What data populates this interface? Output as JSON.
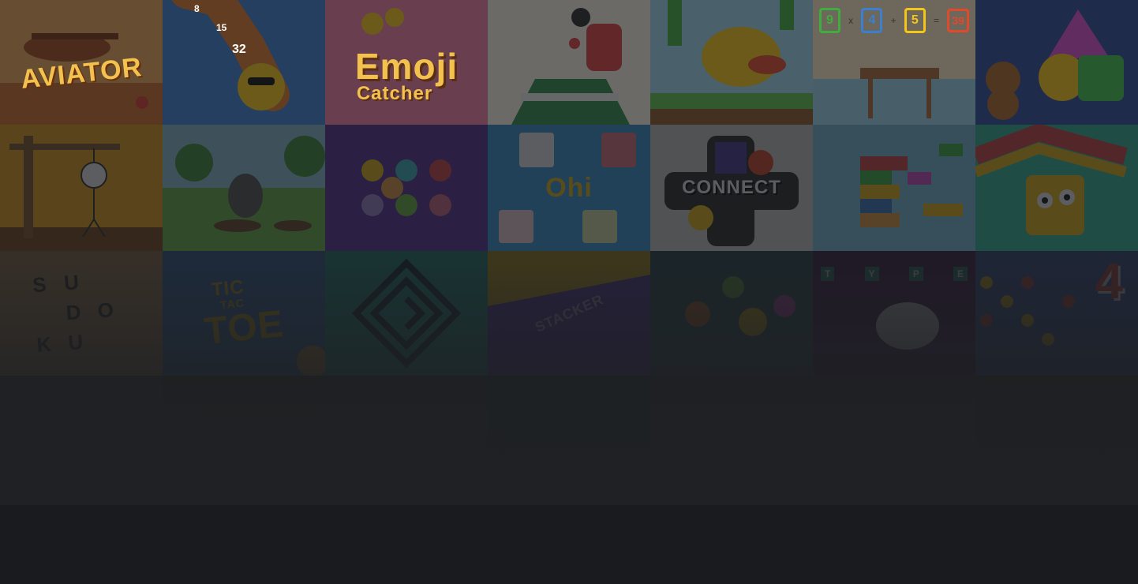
{
  "tiles": {
    "aviator": {
      "label": "AVIATOR",
      "bg": "#e9a65a",
      "accent": "#f2c14e"
    },
    "numbers": {
      "labels": [
        "8",
        "15",
        "32"
      ],
      "bg": "#3a7fd0"
    },
    "emoji": {
      "title": "Emoji",
      "subtitle": "Catcher",
      "bg": "#ee7fa3"
    },
    "pingpong": {
      "bg": "#f6efe2"
    },
    "flappy": {
      "bg": "#9fd7f0"
    },
    "math": {
      "values": [
        "9",
        "x",
        "4",
        "+",
        "5",
        "=",
        "39"
      ],
      "bg": "#fbe7c3"
    },
    "shapes": {
      "bg": "#2f4a9a"
    },
    "hangman": {
      "bg": "#f4a91e"
    },
    "mole": {
      "bg": "#6fbf4a"
    },
    "dots": {
      "bg": "#5b2fa0"
    },
    "ohi": {
      "label": "Ohi",
      "bg": "#3aa0e8"
    },
    "connect": {
      "label": "CONNECT",
      "bg": "#d9d9d9"
    },
    "blocks": {
      "bg": "#7fd0f0"
    },
    "snake": {
      "bg": "#33c7a8"
    },
    "sudoku": {
      "letters": [
        "S",
        "U",
        "D",
        "O",
        "K",
        "U"
      ],
      "bg": "#d49a62"
    },
    "tictactoe": {
      "lines": [
        "TIC",
        "TAC",
        "TOE"
      ],
      "bg": "#3a7fd0"
    },
    "maze": {
      "bg": "#1fb0a0"
    },
    "stacker": {
      "label": "STACKER",
      "bg": "#6a3ec8"
    },
    "fruits": {
      "bg": "#2b5f6a"
    },
    "typing": {
      "letters": [
        "T",
        "Y",
        "P",
        "E"
      ],
      "bg": "#4b1e5a"
    },
    "four": {
      "label": "4",
      "bg": "#3a5fb0"
    }
  }
}
